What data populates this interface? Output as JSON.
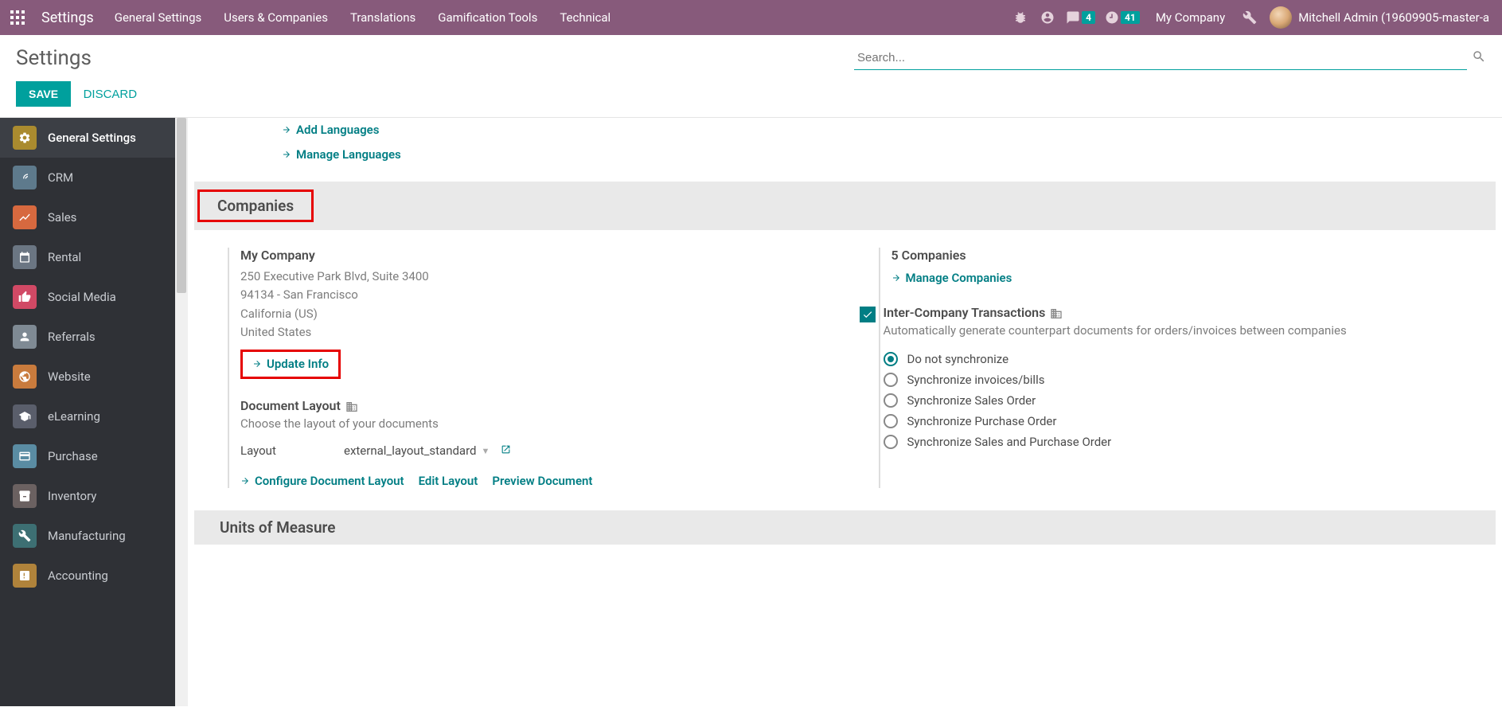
{
  "navbar": {
    "brand": "Settings",
    "items": [
      "General Settings",
      "Users & Companies",
      "Translations",
      "Gamification Tools",
      "Technical"
    ],
    "chat_count": "4",
    "activity_count": "41",
    "company": "My Company",
    "user": "Mitchell Admin (19609905-master-a"
  },
  "control": {
    "title": "Settings",
    "search_placeholder": "Search...",
    "save": "SAVE",
    "discard": "DISCARD"
  },
  "sidebar": {
    "items": [
      "General Settings",
      "CRM",
      "Sales",
      "Rental",
      "Social Media",
      "Referrals",
      "Website",
      "eLearning",
      "Purchase",
      "Inventory",
      "Manufacturing",
      "Accounting"
    ]
  },
  "lang": {
    "add": "Add Languages",
    "manage": "Manage Languages"
  },
  "companies": {
    "header": "Companies",
    "name": "My Company",
    "addr1": "250 Executive Park Blvd, Suite 3400",
    "addr2": "94134 - San Francisco",
    "addr3": "California (US)",
    "addr4": "United States",
    "update": "Update Info",
    "doc_layout": "Document Layout",
    "doc_desc": "Choose the layout of your documents",
    "layout_label": "Layout",
    "layout_value": "external_layout_standard",
    "conf_doc": "Configure Document Layout",
    "edit_layout": "Edit Layout",
    "preview_doc": "Preview Document",
    "count": "5 Companies",
    "manage": "Manage Companies",
    "inter_title": "Inter-Company Transactions",
    "inter_desc": "Automatically generate counterpart documents for orders/invoices between companies",
    "radios": [
      "Do not synchronize",
      "Synchronize invoices/bills",
      "Synchronize Sales Order",
      "Synchronize Purchase Order",
      "Synchronize Sales and Purchase Order"
    ]
  },
  "units": {
    "header": "Units of Measure"
  }
}
